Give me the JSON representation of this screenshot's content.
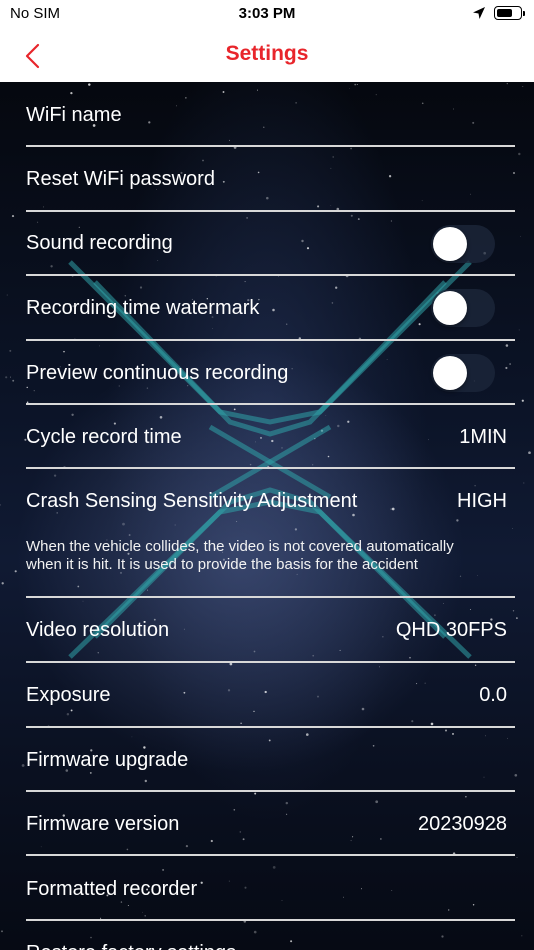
{
  "status_bar": {
    "carrier": "No SIM",
    "time": "3:03 PM",
    "battery_level": 0.7,
    "location_icon": "location-arrow-icon"
  },
  "nav": {
    "title": "Settings",
    "back_icon": "chevron-left-icon",
    "accent_color": "#e8252b"
  },
  "settings": {
    "wifi_name": {
      "label": "WiFi name"
    },
    "reset_wifi_password": {
      "label": "Reset WiFi password"
    },
    "sound_recording": {
      "label": "Sound recording",
      "enabled": false
    },
    "recording_time_watermark": {
      "label": "Recording time watermark",
      "enabled": false
    },
    "preview_continuous_recording": {
      "label": "Preview continuous recording",
      "enabled": false
    },
    "cycle_record_time": {
      "label": "Cycle record time",
      "value": "1MIN"
    },
    "crash_sensing": {
      "label": "Crash Sensing Sensitivity Adjustment",
      "value": "HIGH",
      "note": "When the vehicle collides, the video is not covered automatically when it is hit. It is used to provide the basis for the accident"
    },
    "video_resolution": {
      "label": "Video resolution",
      "value": "QHD 30FPS"
    },
    "exposure": {
      "label": "Exposure",
      "value": "0.0"
    },
    "firmware_upgrade": {
      "label": "Firmware upgrade"
    },
    "firmware_version": {
      "label": "Firmware version",
      "value": "20230928"
    },
    "formatted_recorder": {
      "label": "Formatted recorder"
    },
    "restore_factory_settings": {
      "label": "Restore factory settings"
    }
  }
}
